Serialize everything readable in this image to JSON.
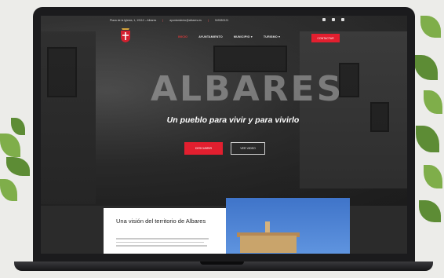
{
  "topbar": {
    "address": "Plaza de la Iglesia, 1, 19112 – Albares",
    "email": "ayuntamiento@albares.es",
    "phone": "949382121"
  },
  "nav": {
    "items": [
      "INICIO",
      "AYUNTAMIENTO",
      "MUNICIPIO",
      "TURISMO"
    ],
    "active": "INICIO",
    "cta": "CONTACTAR"
  },
  "hero": {
    "title": "ALBARES",
    "subtitle": "Un pueblo para vivir y para vivirlo",
    "primary_button": "DESCUBRIR",
    "secondary_button": "VER VIDEO"
  },
  "section": {
    "title": "Una visión del territorio de Albares"
  },
  "colors": {
    "accent": "#e21f2f",
    "sky": "#4a80d0"
  },
  "icons": [
    "coat-of-arms-icon",
    "facebook-icon",
    "instagram-icon",
    "youtube-icon"
  ]
}
